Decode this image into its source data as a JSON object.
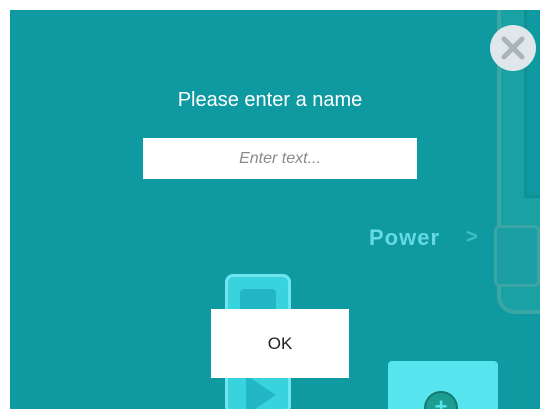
{
  "dialog": {
    "title": "Please enter a name",
    "input_value": "",
    "input_placeholder": "Enter text...",
    "ok_label": "OK"
  },
  "background": {
    "power_label": "Power",
    "chevron": ">",
    "add_symbol": "+"
  },
  "icons": {
    "close": "close-x-icon",
    "play": "play-triangle-icon",
    "add": "plus-circle-icon"
  },
  "colors": {
    "overlay_teal": "#0f9aa2",
    "accent_cyan": "#39d3de",
    "power_text": "#65d9e4",
    "close_bg": "#dfe7ea",
    "close_x": "#b9c3c7"
  }
}
